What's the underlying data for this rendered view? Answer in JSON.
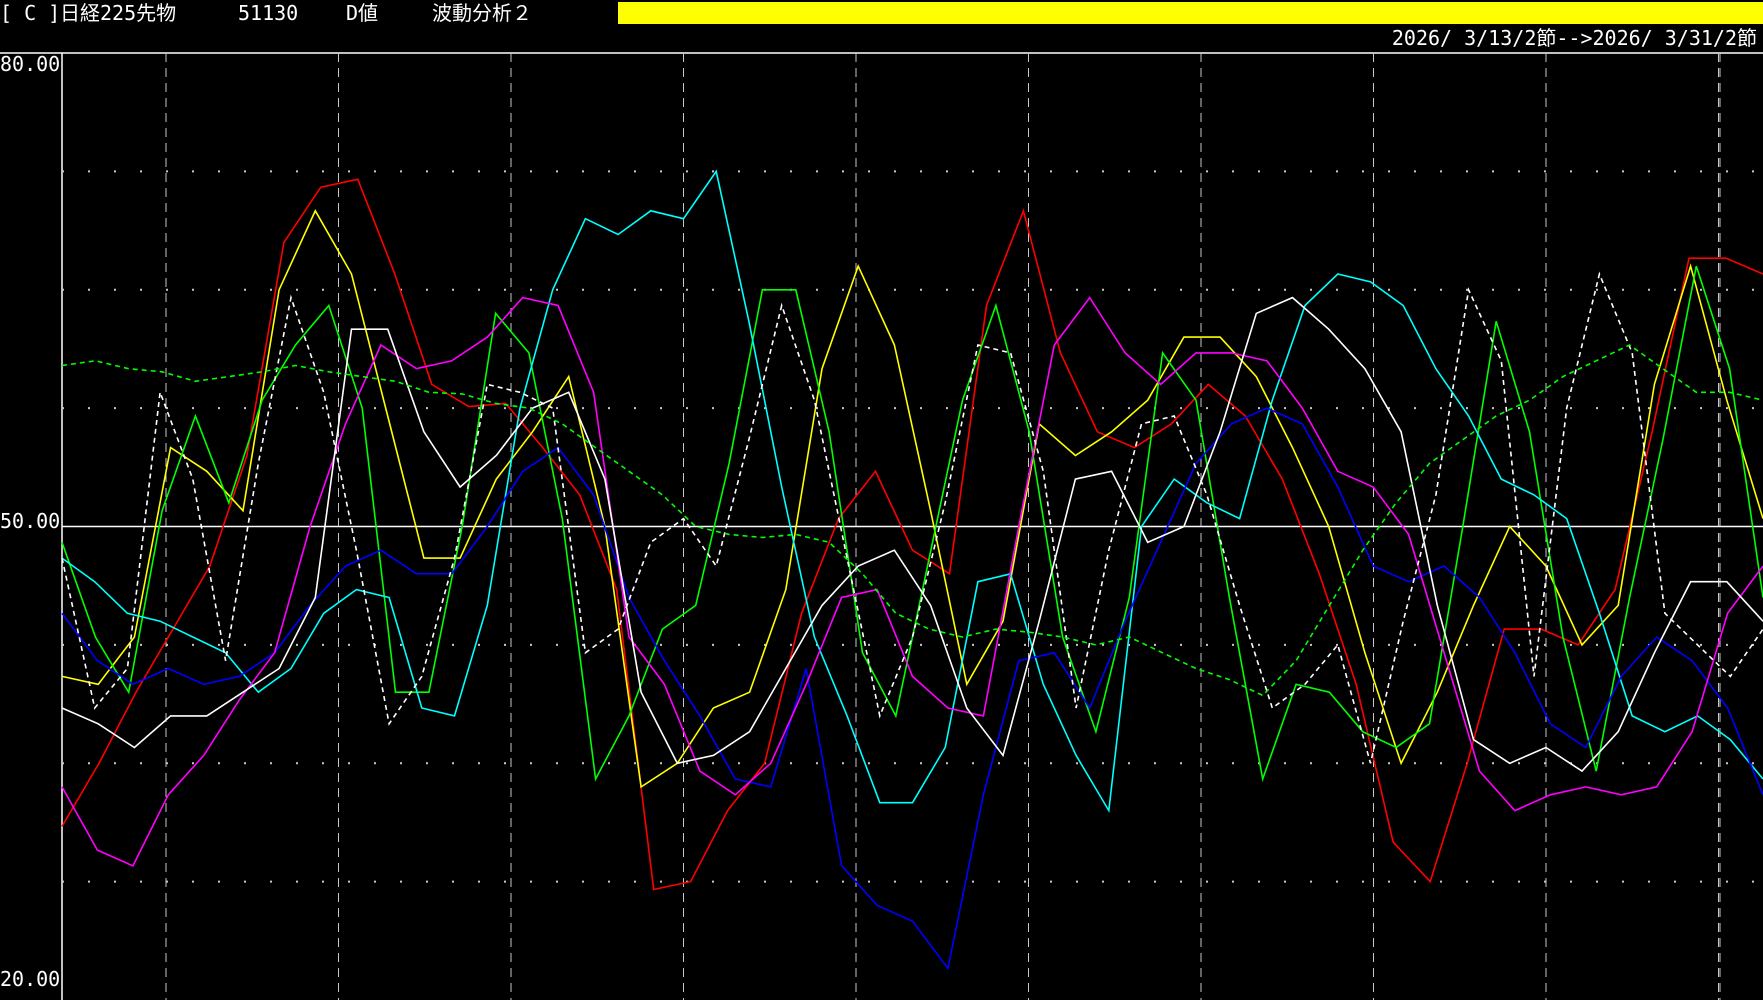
{
  "header": {
    "code": "[ C ]",
    "instrument": "日経225先物",
    "price": "51130",
    "indicator": "D値",
    "analysis": "波動分析２",
    "period": "2026/ 3/13/2節-->2026/ 3/31/2節"
  },
  "colors": {
    "background": "#000000",
    "bar": "#ffff00",
    "grid": "#c8c8c8",
    "axis": "#ffffff"
  },
  "chart_data": {
    "type": "line",
    "ylim": [
      20,
      80
    ],
    "yticks": [
      "80.00",
      "50.00",
      "20.00"
    ],
    "x": [
      0,
      1,
      2,
      3,
      4,
      5,
      6,
      7,
      8,
      9,
      10,
      11,
      12,
      13,
      14,
      15,
      16,
      17,
      18,
      19,
      20,
      21,
      22,
      23,
      24,
      25,
      26,
      27,
      28,
      29,
      30,
      31,
      32,
      33,
      34,
      35,
      36,
      37,
      38,
      39,
      40,
      41,
      42,
      43,
      44,
      45,
      46,
      47,
      48,
      49,
      50
    ],
    "series": [
      {
        "color": "#ff0000",
        "dashed": false,
        "values": [
          31.0,
          35.0,
          39.5,
          43.5,
          47.5,
          54.5,
          68.0,
          71.5,
          72.0,
          66.0,
          59.0,
          57.6,
          57.8,
          55.0,
          52.0,
          46.0,
          27.0,
          27.5,
          32.0,
          35.0,
          44.5,
          50.5,
          53.5,
          48.5,
          47.0,
          64.0,
          70.0,
          61.0,
          56.0,
          55.0,
          56.5,
          59.0,
          57.0,
          53.0,
          47.0,
          40.0,
          30.0,
          27.5,
          35.0,
          43.5,
          43.5,
          42.5,
          46.0,
          56.0,
          67.0,
          67.0,
          66.0
        ]
      },
      {
        "color": "#ffff00",
        "dashed": false,
        "values": [
          40.5,
          40.0,
          43.0,
          55.0,
          53.5,
          51.0,
          65.0,
          70.0,
          66.0,
          57.0,
          48.0,
          48.0,
          53.0,
          56.0,
          59.5,
          50.0,
          33.5,
          35.0,
          38.5,
          39.5,
          46.0,
          60.0,
          66.5,
          61.5,
          51.0,
          40.0,
          44.0,
          56.5,
          54.5,
          56.0,
          58.0,
          62.0,
          62.0,
          59.5,
          55.0,
          50.0,
          42.0,
          35.0,
          39.5,
          45.0,
          50.0,
          47.5,
          42.5,
          45.0,
          59.0,
          66.5,
          58.0,
          50.5
        ]
      },
      {
        "color": "#00ff00",
        "dashed": false,
        "values": [
          49.0,
          43.0,
          39.5,
          51.0,
          57.0,
          51.5,
          58.0,
          61.5,
          64.0,
          57.5,
          39.5,
          39.5,
          50.0,
          63.5,
          61.0,
          50.5,
          34.0,
          38.0,
          43.5,
          45.0,
          54.0,
          65.0,
          65.0,
          56.0,
          42.0,
          38.0,
          48.0,
          58.0,
          64.0,
          56.0,
          43.0,
          37.0,
          45.5,
          61.0,
          58.0,
          45.5,
          34.0,
          40.0,
          39.5,
          37.0,
          36.0,
          37.5,
          50.0,
          63.0,
          56.0,
          43.0,
          34.5,
          45.5,
          55.5,
          66.5,
          60.0,
          45.5
        ]
      },
      {
        "color": "#00ffff",
        "dashed": false,
        "values": [
          48.0,
          46.5,
          44.5,
          44.0,
          43.0,
          42.0,
          39.5,
          41.0,
          44.5,
          46.0,
          45.5,
          38.5,
          38.0,
          45.0,
          57.5,
          65.0,
          69.5,
          68.5,
          70.0,
          69.5,
          72.5,
          63.0,
          52.5,
          43.0,
          38.0,
          32.5,
          32.5,
          36.0,
          46.5,
          47.0,
          40.0,
          35.5,
          32.0,
          50.0,
          53.0,
          51.5,
          50.5,
          58.0,
          64.0,
          66.0,
          65.5,
          64.0,
          60.0,
          57.0,
          53.0,
          52.0,
          50.5,
          44.5,
          38.0,
          37.0,
          38.0,
          36.5,
          34.0
        ]
      },
      {
        "color": "#0000ff",
        "dashed": false,
        "values": [
          44.5,
          41.5,
          40.0,
          41.0,
          40.0,
          40.5,
          42.0,
          45.0,
          47.5,
          48.5,
          47.0,
          47.0,
          50.0,
          53.5,
          55.0,
          52.0,
          45.5,
          41.5,
          38.0,
          34.0,
          33.5,
          41.0,
          28.5,
          26.0,
          25.0,
          22.0,
          33.0,
          41.5,
          42.0,
          38.5,
          44.0,
          49.0,
          54.0,
          56.5,
          57.5,
          56.5,
          52.5,
          47.5,
          46.5,
          47.5,
          45.5,
          42.0,
          37.5,
          36.0,
          40.5,
          43.0,
          41.5,
          38.5,
          33.0
        ]
      },
      {
        "color": "#ff00ff",
        "dashed": false,
        "values": [
          33.5,
          29.5,
          28.5,
          33.0,
          35.5,
          39.0,
          42.0,
          50.0,
          56.5,
          61.5,
          60.0,
          60.5,
          62.0,
          64.5,
          64.0,
          58.5,
          43.0,
          40.0,
          34.5,
          33.0,
          35.0,
          40.0,
          45.5,
          46.0,
          40.5,
          38.5,
          38.0,
          50.0,
          61.5,
          64.5,
          61.0,
          59.0,
          61.0,
          61.0,
          60.5,
          57.5,
          53.5,
          52.5,
          49.5,
          42.0,
          34.5,
          32.0,
          33.0,
          33.5,
          33.0,
          33.5,
          37.0,
          44.5,
          47.5
        ]
      },
      {
        "color": "#ffffff",
        "dashed": false,
        "values": [
          38.5,
          37.5,
          36.0,
          38.0,
          38.0,
          39.5,
          41.0,
          45.5,
          62.5,
          62.5,
          56.0,
          52.5,
          54.5,
          57.5,
          58.5,
          53.0,
          39.5,
          35.0,
          35.5,
          37.0,
          41.0,
          45.0,
          47.5,
          48.5,
          45.0,
          38.5,
          35.5,
          44.0,
          53.0,
          53.5,
          49.0,
          50.0,
          56.0,
          63.5,
          64.5,
          62.5,
          60.0,
          56.0,
          45.0,
          36.5,
          35.0,
          36.0,
          34.5,
          37.0,
          42.0,
          46.5,
          46.5,
          44.0
        ]
      },
      {
        "color": "#ffffff",
        "dashed": true,
        "values": [
          48.0,
          38.5,
          41.0,
          58.5,
          53.0,
          41.5,
          54.0,
          64.5,
          58.5,
          48.5,
          37.5,
          40.5,
          48.0,
          59.0,
          58.5,
          57.5,
          42.0,
          43.5,
          49.0,
          50.5,
          47.5,
          55.5,
          64.0,
          58.0,
          48.0,
          38.0,
          43.0,
          51.5,
          61.5,
          61.0,
          53.5,
          38.5,
          48.5,
          56.5,
          57.0,
          52.0,
          45.0,
          38.5,
          40.0,
          42.5,
          35.0,
          44.0,
          52.0,
          65.0,
          60.5,
          40.5,
          57.5,
          66.0,
          61.0,
          44.5,
          42.5,
          40.5,
          43.5
        ]
      },
      {
        "color": "#00ff00",
        "dashed": true,
        "values": [
          60.2,
          60.5,
          60.0,
          59.8,
          59.2,
          59.5,
          59.8,
          60.2,
          59.8,
          59.5,
          59.2,
          58.5,
          58.4,
          57.8,
          57.5,
          56.5,
          55.0,
          53.5,
          52.0,
          50.0,
          49.5,
          49.3,
          49.5,
          49.0,
          47.0,
          44.5,
          43.5,
          43.0,
          43.5,
          43.3,
          43.0,
          42.5,
          43.0,
          42.0,
          41.0,
          40.3,
          39.3,
          41.5,
          45.0,
          48.5,
          51.5,
          54.0,
          55.5,
          57.0,
          58.0,
          59.5,
          60.5,
          61.5,
          60.0,
          58.5,
          58.5,
          58.0
        ]
      }
    ]
  }
}
